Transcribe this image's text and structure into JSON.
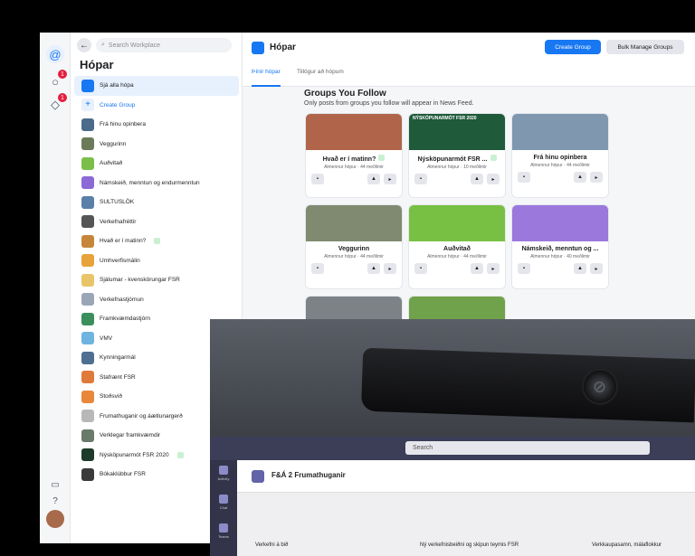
{
  "rail": {
    "icons": [
      "workplace-logo-icon",
      "notifications-icon",
      "chat-icon"
    ],
    "badges": [
      "1",
      "1"
    ],
    "bottom_icons": [
      "feedback-icon",
      "help-icon",
      "avatar"
    ]
  },
  "sidebar": {
    "search_placeholder": "Search Workplace",
    "title": "Hópar",
    "items": [
      {
        "label": "Sjá alla hópa",
        "color": "#1877f2",
        "active": true
      },
      {
        "label": "Create Group",
        "color": "#e7f0fd",
        "create": true
      },
      {
        "label": "Frá hinu opinbera",
        "color": "#4a6b8a"
      },
      {
        "label": "Veggurinn",
        "color": "#6b7b5a"
      },
      {
        "label": "Auðvitað",
        "color": "#7bbf4a"
      },
      {
        "label": "Námskeið, menntun og endurmenntun",
        "color": "#8c6ad6"
      },
      {
        "label": "SULTUSLÖK",
        "color": "#5a7fa8"
      },
      {
        "label": "Verkefnafréttir",
        "color": "#555555"
      },
      {
        "label": "Hvað er í matinn?",
        "color": "#c6863a",
        "badge": true
      },
      {
        "label": "Umhverfismálin",
        "color": "#e8a23a"
      },
      {
        "label": "Sjálumar - kvenskörungar FSR",
        "color": "#e9c56a"
      },
      {
        "label": "Verkefnastjórnun",
        "color": "#9aa6b8"
      },
      {
        "label": "Framkvæmdastjórn",
        "color": "#3a8f5c"
      },
      {
        "label": "VMV",
        "color": "#6fb3e0"
      },
      {
        "label": "Kynningarmál",
        "color": "#4e6f92"
      },
      {
        "label": "Stafrænt FSR",
        "color": "#e07a3a"
      },
      {
        "label": "Stoðsvið",
        "color": "#e8873a"
      },
      {
        "label": "Frumathuganir og áætlunargerð",
        "color": "#b8b8b8"
      },
      {
        "label": "Verklegar framkvæmdir",
        "color": "#6a7a6a"
      },
      {
        "label": "Nýsköpunarmót FSR 2020",
        "color": "#1e3a2a",
        "badge": true
      },
      {
        "label": "Bókaklúbbur FSR",
        "color": "#3a3a3a"
      }
    ]
  },
  "main": {
    "title": "Hópar",
    "create_label": "Create Group",
    "bulk_label": "Bulk Manage Groups",
    "tabs": [
      "Þínir hópar",
      "Tillögur að hópum"
    ],
    "section_title": "Groups You Follow",
    "section_sub": "Only posts from groups you follow will appear in News Feed.",
    "cards": [
      {
        "name": "Hvað er í matinn?",
        "meta": "Almennur hópur · 44 meðlimir",
        "color": "#b0654a",
        "badge": true
      },
      {
        "name": "Nýsköpunarmót FSR ...",
        "meta": "Almennur hópur · 10 meðlimir",
        "color": "#1f5a3a",
        "badge": true,
        "banner": "NÝSKÖPUNARMÓT FSR 2020"
      },
      {
        "name": "Frá hinu opinbera",
        "meta": "Almennur hópur · 44 meðlimir",
        "color": "#7f98b0"
      },
      {
        "name": "Veggurinn",
        "meta": "Almennur hópur · 44 meðlimir",
        "color": "#808a70"
      },
      {
        "name": "Auðvitað",
        "meta": "Almennur hópur · 44 meðlimir",
        "color": "#78c043"
      },
      {
        "name": "Námskeið, menntun og ...",
        "meta": "Almennur hópur · 40 meðlimir",
        "color": "#9a78dc"
      },
      {
        "name": "",
        "meta": "",
        "color": "#7d8287"
      },
      {
        "name": "",
        "meta": "",
        "color": "#6fa24a"
      }
    ]
  },
  "teams": {
    "search_placeholder": "Search",
    "channel_title": "F&Á 2 Frumathuganir",
    "rail": [
      "Activity",
      "Chat",
      "Teams"
    ],
    "columns": [
      "Verkefni á bið",
      "Ný verkefnisbeiðni og skipun teymis FSR",
      "Verkkaupasamn, málaflokkur"
    ]
  }
}
